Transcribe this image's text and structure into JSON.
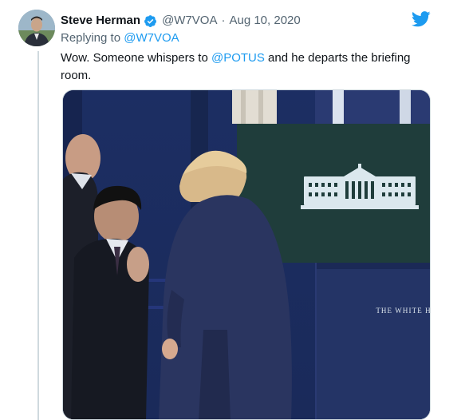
{
  "tweet": {
    "author": {
      "display_name": "Steve Herman",
      "handle": "@W7VOA",
      "verified": true
    },
    "separator": "·",
    "date": "Aug 10, 2020",
    "reply": {
      "prefix": "Replying to ",
      "mention": "@W7VOA"
    },
    "text": {
      "before": "Wow. Someone whispers to ",
      "mention": "@POTUS",
      "after": " and he departs the briefing room."
    },
    "media": {
      "backdrop_text": "THE WHITE HOUSE"
    }
  },
  "colors": {
    "accent": "#1d9bf0",
    "secondary_text": "#536471",
    "thread_line": "#cfd9de"
  },
  "icons": [
    "verified-badge-icon",
    "twitter-bird-icon"
  ]
}
